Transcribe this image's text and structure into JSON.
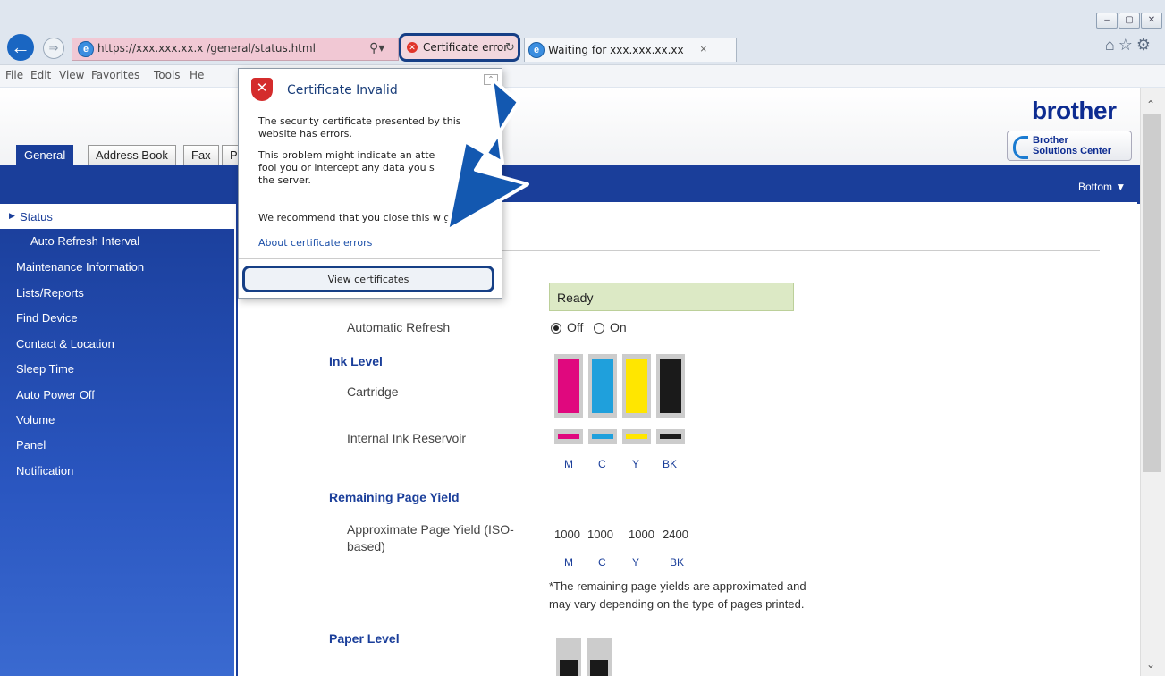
{
  "browser": {
    "address": "https://xxx.xxx.xx.x /general/status.html",
    "search_icon": "search-icon",
    "cert_error_label": "Certificate error",
    "tab_label": "Waiting for xxx.xxx.xx.xx",
    "tab_close": "×",
    "menu": [
      "File",
      "Edit",
      "View",
      "Favorites",
      "Tools",
      "He"
    ],
    "window_controls": [
      "–",
      "▢",
      "✕"
    ],
    "toolbar_icons": [
      "home-icon",
      "star-icon",
      "gear-icon"
    ]
  },
  "popup": {
    "title": "Certificate Invalid",
    "p1": [
      "The security certificate presented by this",
      "website has errors."
    ],
    "p2": [
      "This problem might indicate an atte",
      "fool you or intercept any data you s",
      "the server."
    ],
    "p3": "We recommend that you close this w      ge.",
    "link": "About certificate errors",
    "button": "View certificates"
  },
  "brand": {
    "logo": "brother",
    "solutions_line1": "Brother",
    "solutions_line2": "Solutions Center"
  },
  "tabs": [
    "General",
    "Address Book",
    "Fax",
    "P"
  ],
  "bottom_link": "Bottom ▼",
  "sidebar": {
    "items": [
      "Status",
      "Auto Refresh Interval",
      "Maintenance Information",
      "Lists/Reports",
      "Find Device",
      "Contact & Location",
      "Sleep Time",
      "Auto Power Off",
      "Volume",
      "Panel",
      "Notification"
    ]
  },
  "status": {
    "device_status": "Ready",
    "auto_refresh_label": "Automatic Refresh",
    "off": "Off",
    "on": "On",
    "ink_level": "Ink Level",
    "cartridge": "Cartridge",
    "reservoir": "Internal Ink Reservoir",
    "colors": [
      "M",
      "C",
      "Y",
      "BK"
    ],
    "ink_hex": [
      "#e0087e",
      "#1fa0dc",
      "#ffe600",
      "#1a1a1a"
    ],
    "remaining": "Remaining Page Yield",
    "approx_line1": "Approximate Page Yield (ISO-",
    "approx_line2": "based)",
    "yields": [
      "1000",
      "1000",
      "1000",
      "2400"
    ],
    "note1": "*The remaining page yields are approximated and",
    "note2": "may vary depending on the type of pages printed.",
    "paper_level": "Paper Level"
  }
}
